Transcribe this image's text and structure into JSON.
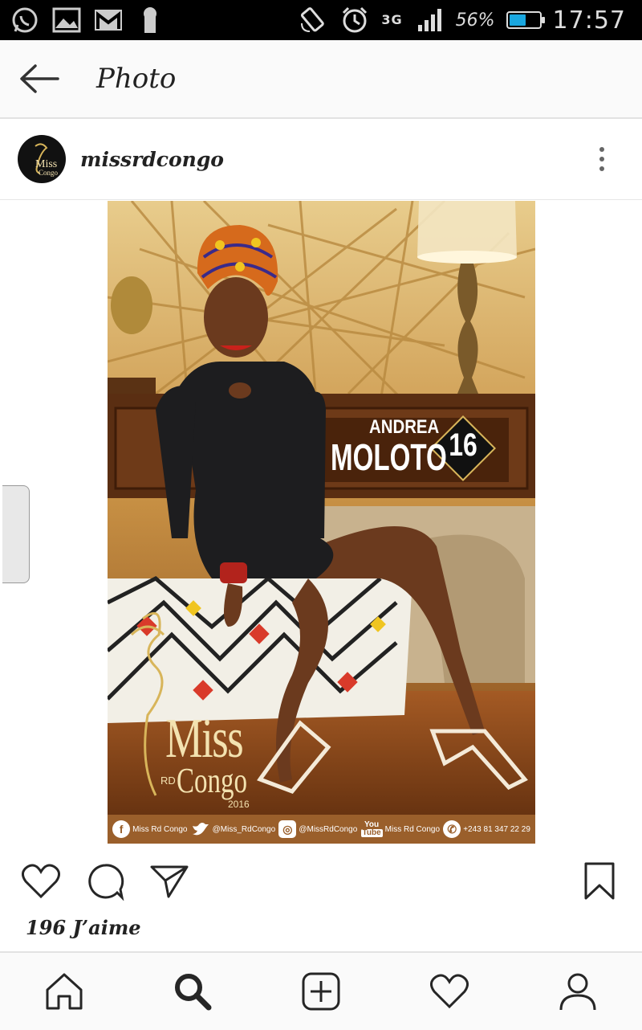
{
  "status_bar": {
    "network": "3G",
    "battery_percent": "56%",
    "battery_level": 0.56,
    "time": "17:57",
    "icons": [
      "whatsapp-icon",
      "gallery-icon",
      "gmail-icon",
      "keyhole-icon",
      "rotate-icon",
      "alarm-icon",
      "signal-icon",
      "battery-icon"
    ]
  },
  "header": {
    "title": "Photo",
    "back_icon": "back-arrow-icon"
  },
  "post": {
    "username": "missrdcongo",
    "more_icon": "more-vertical-icon",
    "image": {
      "first_name": "ANDREA",
      "last_name": "MOLOTO",
      "number": "16",
      "brand_miss": "Miss",
      "brand_rd": "RD",
      "brand_congo": "Congo",
      "brand_year": "2016",
      "social": {
        "facebook": "Miss Rd Congo",
        "twitter": "@Miss_RdCongo",
        "instagram": "@MissRdCongo",
        "youtube_badge_top": "You",
        "youtube_badge_bottom": "Tube",
        "youtube": "Miss Rd Congo",
        "whatsapp": "+243 81 347 22 29"
      }
    },
    "likes": "196 J’aime"
  },
  "actions": [
    "heart-icon",
    "comment-icon",
    "share-icon",
    "bookmark-icon"
  ],
  "bottom_nav": [
    "home-icon",
    "search-icon",
    "add-icon",
    "activity-icon",
    "profile-icon"
  ],
  "colors": {
    "status_bar_bg": "#000000",
    "battery_accent": "#19a7e0",
    "header_bg": "#fafafa",
    "social_strip": "#9a5f2b",
    "gold": "#d8b55a"
  }
}
